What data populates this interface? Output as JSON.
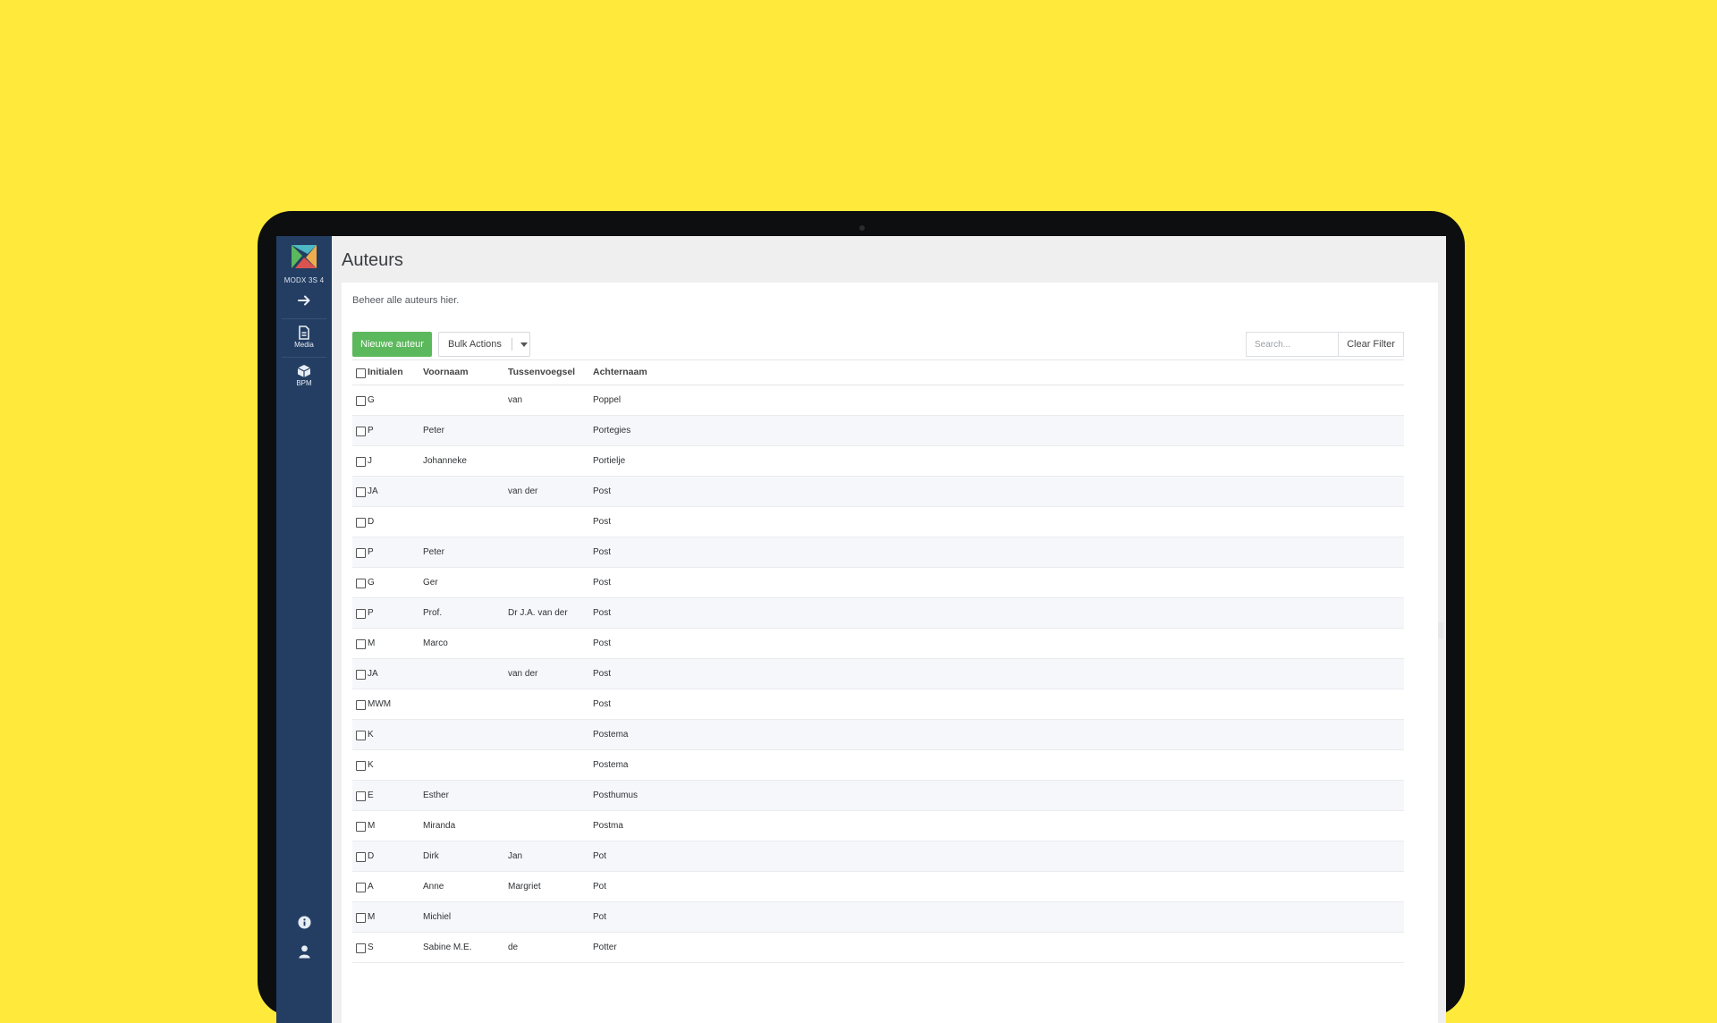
{
  "sidebar": {
    "version": "MODX 3S 4",
    "items": [
      {
        "label": "",
        "icon": "arrow-right-icon"
      },
      {
        "label": "Media",
        "icon": "file-icon"
      },
      {
        "label": "BPM",
        "icon": "package-icon"
      }
    ],
    "bottom": [
      {
        "icon": "info-icon"
      },
      {
        "icon": "user-icon"
      }
    ]
  },
  "page": {
    "title": "Auteurs",
    "description": "Beheer alle auteurs hier."
  },
  "toolbar": {
    "new_label": "Nieuwe auteur",
    "bulk_label": "Bulk Actions",
    "search_placeholder": "Search...",
    "clear_label": "Clear Filter"
  },
  "colors": {
    "accent": "#5cb85c",
    "sidebar": "#243e63",
    "background": "#ffea3b"
  },
  "table": {
    "columns": [
      "Initialen",
      "Voornaam",
      "Tussenvoegsel",
      "Achternaam"
    ],
    "rows": [
      [
        "G",
        "",
        "van",
        "Poppel"
      ],
      [
        "P",
        "Peter",
        "",
        "Portegies"
      ],
      [
        "J",
        "Johanneke",
        "",
        "Portielje"
      ],
      [
        "JA",
        "",
        "van der",
        "Post"
      ],
      [
        "D",
        "",
        "",
        "Post"
      ],
      [
        "P",
        "Peter",
        "",
        "Post"
      ],
      [
        "G",
        "Ger",
        "",
        "Post"
      ],
      [
        "P",
        "Prof.",
        "Dr J.A. van der",
        "Post"
      ],
      [
        "M",
        "Marco",
        "",
        "Post"
      ],
      [
        "JA",
        "",
        "van der",
        "Post"
      ],
      [
        "MWM",
        "",
        "",
        "Post"
      ],
      [
        "K",
        "",
        "",
        "Postema"
      ],
      [
        "K",
        "",
        "",
        "Postema"
      ],
      [
        "E",
        "Esther",
        "",
        "Posthumus"
      ],
      [
        "M",
        "Miranda",
        "",
        "Postma"
      ],
      [
        "D",
        "Dirk",
        "Jan",
        "Pot"
      ],
      [
        "A",
        "Anne",
        "Margriet",
        "Pot"
      ],
      [
        "M",
        "Michiel",
        "",
        "Pot"
      ],
      [
        "S",
        "Sabine M.E.",
        "de",
        "Potter"
      ]
    ]
  }
}
